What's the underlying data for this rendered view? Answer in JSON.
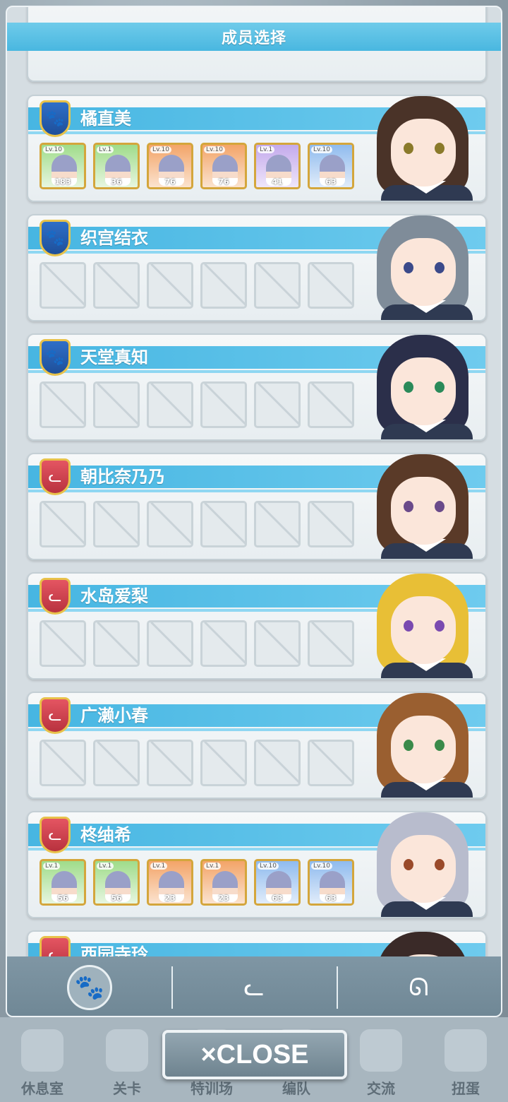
{
  "modal": {
    "title": "成员选择"
  },
  "members": [
    {
      "name": "橘直美",
      "badge": "paw",
      "cards": [
        {
          "level": "Lv.10",
          "num": "183",
          "color": "c-green"
        },
        {
          "level": "Lv.1",
          "num": "36",
          "color": "c-green"
        },
        {
          "level": "Lv.10",
          "num": "76",
          "color": "c-orange"
        },
        {
          "level": "Lv.10",
          "num": "76",
          "color": "c-orange"
        },
        {
          "level": "Lv.1",
          "num": "41",
          "color": "c-purple"
        },
        {
          "level": "Lv.10",
          "num": "63",
          "color": "c-blue"
        }
      ],
      "hair": "#4a3328",
      "eye": "#8a7a2a"
    },
    {
      "name": "织宫结衣",
      "badge": "paw",
      "cards": [],
      "hair": "#7f8c99",
      "eye": "#3b4a8a"
    },
    {
      "name": "天堂真知",
      "badge": "paw",
      "cards": [],
      "hair": "#2b2f4a",
      "eye": "#2a8a5a"
    },
    {
      "name": "朝比奈乃乃",
      "badge": "cat",
      "cards": [],
      "hair": "#5a3a28",
      "eye": "#6a4a8a"
    },
    {
      "name": "水岛爱梨",
      "badge": "cat",
      "cards": [],
      "hair": "#e8bf36",
      "eye": "#7a4ab0"
    },
    {
      "name": "广濑小春",
      "badge": "cat",
      "cards": [],
      "hair": "#9a5f30",
      "eye": "#3a8a4a"
    },
    {
      "name": "柊䌷希",
      "badge": "cat",
      "cards": [
        {
          "level": "Lv.1",
          "num": "56",
          "color": "c-green"
        },
        {
          "level": "Lv.1",
          "num": "56",
          "color": "c-green"
        },
        {
          "level": "Lv.1",
          "num": "23",
          "color": "c-orange"
        },
        {
          "level": "Lv.1",
          "num": "23",
          "color": "c-orange"
        },
        {
          "level": "Lv.10",
          "num": "63",
          "color": "c-blue"
        },
        {
          "level": "Lv.10",
          "num": "63",
          "color": "c-blue"
        }
      ],
      "hair": "#b8bccd",
      "eye": "#9a4a2a"
    },
    {
      "name": "西园寺玲",
      "badge": "cat",
      "cards": [],
      "hair": "#3a2a28",
      "eye": "#4a3a2a"
    }
  ],
  "filters": [
    {
      "icon": "paw-icon",
      "glyph": "🐾",
      "active": true
    },
    {
      "icon": "cat-icon",
      "glyph": "ᓚ",
      "active": false
    },
    {
      "icon": "rabbit-icon",
      "glyph": "ᘏ",
      "active": false
    }
  ],
  "close_button": {
    "label": "×CLOSE"
  },
  "bottom_nav": [
    {
      "label": "休息室"
    },
    {
      "label": "关卡"
    },
    {
      "label": "特训场"
    },
    {
      "label": "编队"
    },
    {
      "label": "交流"
    },
    {
      "label": "扭蛋"
    }
  ]
}
